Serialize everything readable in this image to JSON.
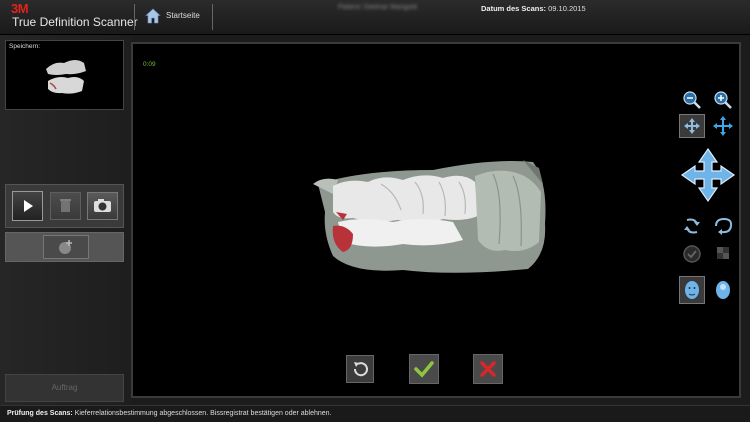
{
  "header": {
    "brand": "3M",
    "app_name": "True Definition Scanner",
    "home_label": "Startseite",
    "patient_text": "Patient: Dietmar Mangold",
    "scan_date_label": "Datum des Scans:",
    "scan_date_value": "09.10.2015"
  },
  "sidebar": {
    "memory_label": "Speichern:",
    "order_button_label": "Auftrag"
  },
  "viewer": {
    "timer": "0:09"
  },
  "status_bar": {
    "label": "Prüfung des Scans:",
    "message": "Kieferrelationsbestimmung abgeschlossen. Bissregistrat bestätigen oder ablehnen."
  },
  "colors": {
    "brand_red": "#e2231a",
    "accept_green": "#8ec63f",
    "reject_red": "#d9262b",
    "accent_blue": "#3ea6e8",
    "timer_green": "#6fbf3f"
  },
  "icons": {
    "home": "home-icon",
    "play": "play-icon",
    "trash": "trash-icon",
    "camera": "camera-icon",
    "add_scan": "add-scan-icon",
    "zoom_out": "zoom-out-icon",
    "zoom_in": "zoom-in-icon",
    "move": "move-icon",
    "pan": "pan-icon",
    "navigation": "navigation-arrows-icon",
    "rotate_ccw": "rotate-left-icon",
    "rotate_cw": "rotate-right-icon",
    "check_view": "check-circle-icon",
    "grid_view": "grid-icon",
    "face_view": "face-front-icon",
    "head_view": "head-side-icon",
    "undo": "undo-icon",
    "accept": "checkmark-icon",
    "reject": "x-icon"
  }
}
